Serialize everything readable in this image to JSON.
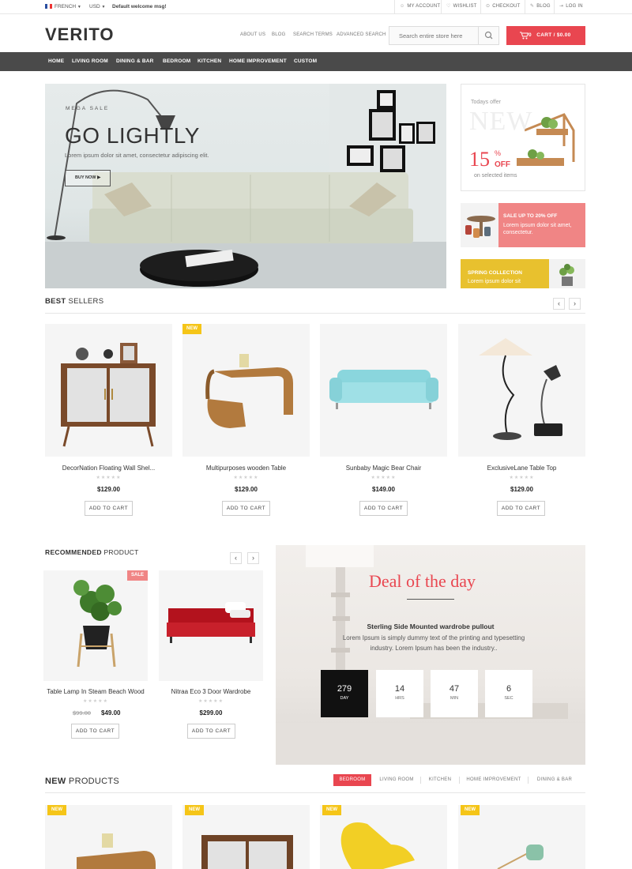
{
  "topbar": {
    "language": "FRENCH",
    "currency": "USD",
    "welcome": "Default welcome msg!",
    "links": [
      "MY ACCOUNT",
      "WISHLIST",
      "CHECKOUT",
      "BLOG",
      "LOG IN"
    ]
  },
  "header": {
    "logo": "VERITO",
    "nav": [
      "ABOUT US",
      "BLOG",
      "SEARCH TERMS",
      "ADVANCED SEARCH"
    ],
    "search_placeholder": "Search entire store here",
    "cart_count": "0",
    "cart_label": "CART / $0.00"
  },
  "mainnav": [
    "HOME",
    "LIVING ROOM",
    "DINING & BAR",
    "BEDROOM",
    "KITCHEN",
    "HOME IMPROVEMENT",
    "CUSTOM"
  ],
  "hero": {
    "kicker": "MEGA SALE",
    "title": "GO LIGHTLY",
    "subtitle": "Lorem ipsum dolor sit amet, consectetur adipiscing elit.",
    "button": "BUY NOW"
  },
  "promos": {
    "p1_label": "Todays offer",
    "p1_big": "NEW",
    "p1_pct": "15",
    "p1_pct_sign": "%",
    "p1_off": "OFF",
    "p1_note": "on selected items",
    "p2_title": "SALE UP TO 20% OFF",
    "p2_text": "Lorem ipsum dolor sit amet, consectetur.",
    "p3_title": "SPRING COLLECTION",
    "p3_text": "Lorem ipsum dolor sit"
  },
  "bestsellers": {
    "title_bold": "BEST",
    "title_rest": " SELLERS",
    "items": [
      {
        "name": "DecorNation Floating Wall Shel...",
        "price": "$129.00",
        "badge": ""
      },
      {
        "name": "Multipurposes wooden Table",
        "price": "$129.00",
        "badge": "NEW"
      },
      {
        "name": "Sunbaby Magic Bear Chair",
        "price": "$149.00",
        "badge": ""
      },
      {
        "name": "ExclusiveLane Table Top",
        "price": "$129.00",
        "badge": ""
      }
    ],
    "add_label": "ADD TO CART",
    "stars": "★★★★★"
  },
  "recommended": {
    "title_bold": "RECOMMENDED",
    "title_rest": " PRODUCT",
    "items": [
      {
        "name": "Table Lamp In Steam Beach Wood",
        "old_price": "$99.00",
        "price": "$49.00",
        "badge": "SALE"
      },
      {
        "name": "Nitraa Eco 3 Door Wardrobe",
        "price": "$299.00"
      }
    ]
  },
  "deal": {
    "title": "Deal of the day",
    "product": "Sterling Side Mounted wardrobe pullout",
    "desc": "Lorem Ipsum is simply dummy text of the printing and typesetting industry. Lorem Ipsum has been the industry..",
    "countdown": [
      {
        "value": "279",
        "label": "DAY"
      },
      {
        "value": "14",
        "label": "HRS"
      },
      {
        "value": "47",
        "label": "MIN"
      },
      {
        "value": "6",
        "label": "SEC"
      }
    ]
  },
  "newproducts": {
    "title_bold": "NEW",
    "title_rest": " PRODUCTS",
    "tabs": [
      "BEDROOM",
      "LIVING ROOM",
      "KITCHEN",
      "HOME IMPROVEMENT",
      "DINING & BAR"
    ],
    "badge": "NEW"
  },
  "colors": {
    "accent": "#e94650",
    "nav_bg": "#4a4a4a",
    "badge_new": "#f5c518",
    "badge_sale": "#f08585"
  }
}
